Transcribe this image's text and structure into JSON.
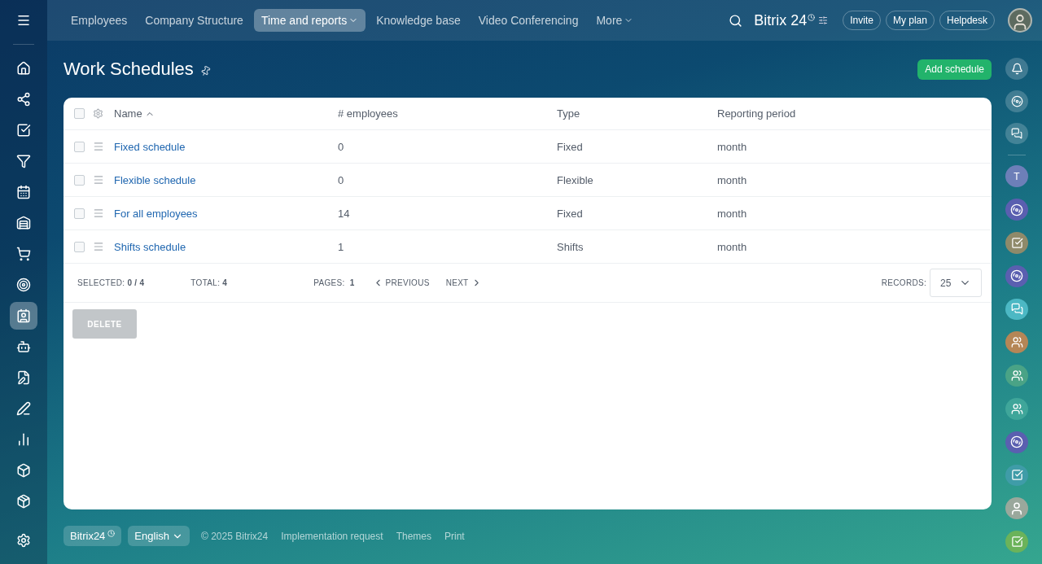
{
  "sidebar": {
    "items": [
      {
        "selected": false
      },
      {
        "selected": false
      },
      {
        "selected": false
      },
      {
        "selected": false
      },
      {
        "selected": false
      },
      {
        "selected": false
      },
      {
        "selected": false
      },
      {
        "selected": false
      },
      {
        "selected": true
      },
      {
        "selected": false
      },
      {
        "selected": false
      },
      {
        "selected": false
      },
      {
        "selected": false
      },
      {
        "selected": false
      },
      {
        "selected": false
      }
    ]
  },
  "top_nav": {
    "items": [
      {
        "label": "Employees",
        "selected": false,
        "dropdown": false
      },
      {
        "label": "Company Structure",
        "selected": false,
        "dropdown": false
      },
      {
        "label": "Time and reports",
        "selected": true,
        "dropdown": true
      },
      {
        "label": "Knowledge base",
        "selected": false,
        "dropdown": false
      },
      {
        "label": "Video Conferencing",
        "selected": false,
        "dropdown": false
      },
      {
        "label": "More",
        "selected": false,
        "dropdown": true
      }
    ],
    "logo": "Bitrix 24",
    "buttons": [
      "Invite",
      "My plan",
      "Helpdesk"
    ]
  },
  "page": {
    "title": "Work Schedules",
    "add_button": "Add schedule"
  },
  "table": {
    "all_checked": false,
    "columns": [
      "Name",
      "# employees",
      "Type",
      "Reporting period"
    ],
    "rows": [
      {
        "name": "Fixed schedule",
        "employees": "0",
        "type": "Fixed",
        "period": "month",
        "checked": false
      },
      {
        "name": "Flexible schedule",
        "employees": "0",
        "type": "Flexible",
        "period": "month",
        "checked": false
      },
      {
        "name": "For all employees",
        "employees": "14",
        "type": "Fixed",
        "period": "month",
        "checked": false
      },
      {
        "name": "Shifts schedule",
        "employees": "1",
        "type": "Shifts",
        "period": "month",
        "checked": false
      }
    ],
    "footer": {
      "selected_label": "SELECTED:",
      "selected_value": "0 / 4",
      "total_label": "TOTAL:",
      "total_value": "4",
      "pages_label": "PAGES:",
      "pages_value": "1",
      "previous": "PREVIOUS",
      "next": "NEXT",
      "records_label": "RECORDS:",
      "records_value": "25"
    },
    "delete_button": {
      "label": "DELETE",
      "disabled": true
    }
  },
  "right_rail": {
    "items": [
      {
        "kind": "letter",
        "text": "T",
        "color": "#6d7fb8"
      },
      {
        "kind": "swirl",
        "color": "#5a5fb0"
      },
      {
        "kind": "task",
        "color": "#8f8a6a"
      },
      {
        "kind": "swirl",
        "color": "#5a5fb0"
      },
      {
        "kind": "chat",
        "color": "#4cb8c4"
      },
      {
        "kind": "group",
        "color": "#b58656"
      },
      {
        "kind": "group",
        "color": "#4aa386"
      },
      {
        "kind": "group",
        "color": "#3fa69a"
      },
      {
        "kind": "swirl",
        "color": "#5a5fb0"
      },
      {
        "kind": "task",
        "color": "#3f9ca8"
      },
      {
        "kind": "person",
        "color": "#9aa89c"
      },
      {
        "kind": "task",
        "color": "#6bb35a"
      }
    ]
  },
  "footer": {
    "brand": "Bitrix24",
    "language": "English",
    "copyright": "© 2025 Bitrix24",
    "links": [
      "Implementation request",
      "Themes",
      "Print"
    ]
  }
}
